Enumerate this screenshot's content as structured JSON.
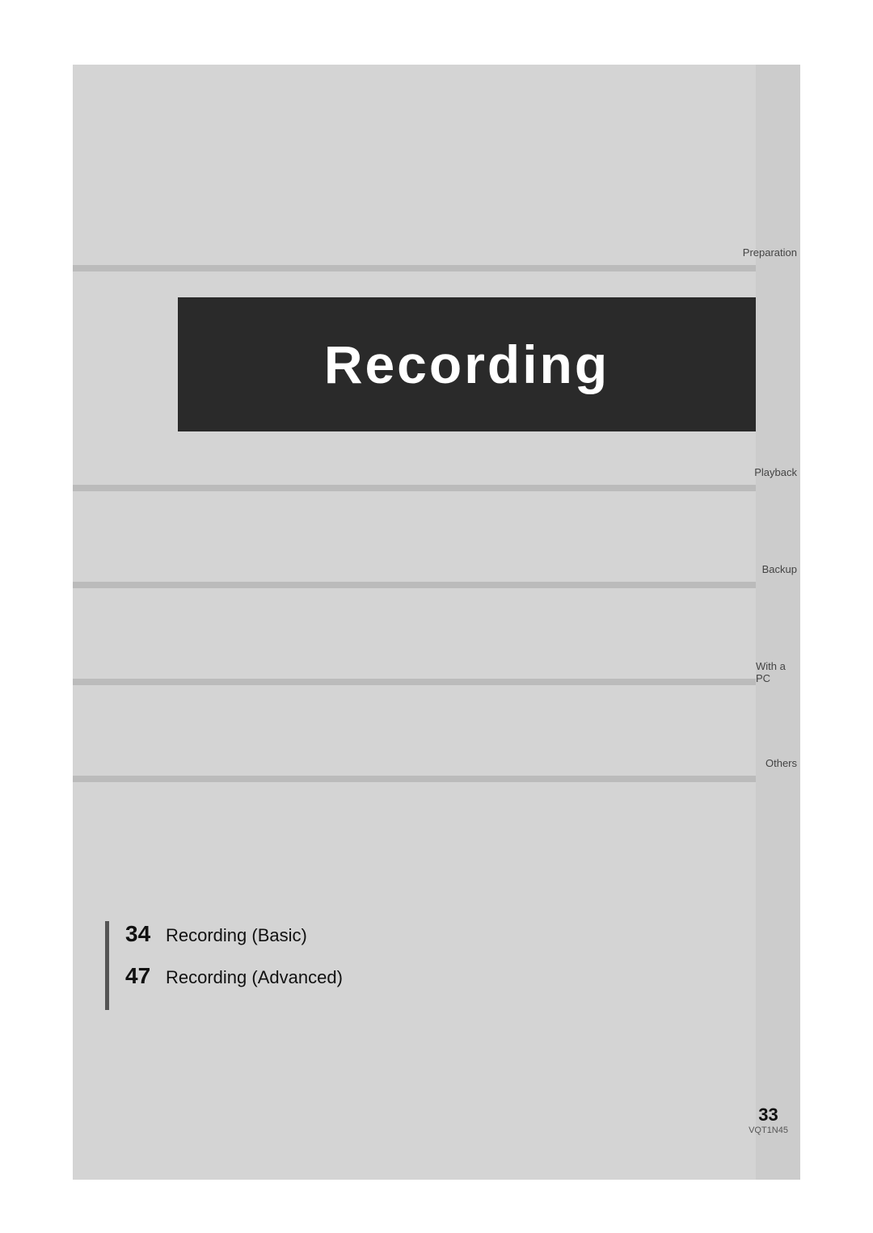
{
  "page": {
    "background_color": "#ffffff",
    "content_bg": "#d4d4d4"
  },
  "sections": {
    "preparation": {
      "label": "Preparation",
      "position": "top"
    },
    "recording": {
      "title": "Recording",
      "bg_color": "#2a2a2a",
      "text_color": "#ffffff"
    },
    "playback": {
      "label": "Playback"
    },
    "backup": {
      "label": "Backup"
    },
    "with_pc": {
      "label": "With a PC"
    },
    "others": {
      "label": "Others"
    }
  },
  "toc": {
    "items": [
      {
        "number": "34",
        "text": "Recording (Basic)"
      },
      {
        "number": "47",
        "text": "Recording (Advanced)"
      }
    ]
  },
  "footer": {
    "page_number": "33",
    "code": "VQT1N45"
  }
}
